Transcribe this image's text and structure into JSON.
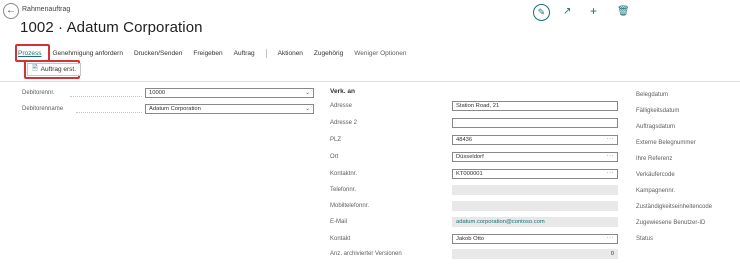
{
  "header": {
    "page_kind": "Rahmenauftrag",
    "title": "1002 · Adatum Corporation"
  },
  "menu": [
    "Prozess",
    "Genehmigung anfordern",
    "Drucken/Senden",
    "Freigeben",
    "Auftrag",
    "Aktionen",
    "Zugehörig",
    "Weniger Optionen"
  ],
  "actions": {
    "create_order": "Auftrag erst."
  },
  "left_fields": [
    {
      "label": "Debitorennr.",
      "value": "10000"
    },
    {
      "label": "Debitorenname",
      "value": "Adatum Corporation"
    }
  ],
  "sell_to": {
    "heading": "Verk. an",
    "fields": [
      {
        "label": "Adresse",
        "value": "Station Road, 21"
      },
      {
        "label": "Adresse 2",
        "value": ""
      },
      {
        "label": "PLZ",
        "value": "48436"
      },
      {
        "label": "Ort",
        "value": "Düsseldorf"
      },
      {
        "label": "Kontaktnr.",
        "value": "KT000001"
      },
      {
        "label": "Telefonnr.",
        "value": ""
      },
      {
        "label": "Mobiltelefonnr.",
        "value": ""
      },
      {
        "label": "E-Mail",
        "value": "adatum.corporation@contoso.com"
      },
      {
        "label": "Kontakt",
        "value": "Jakob Otto"
      },
      {
        "label": "Anz. archivierter Versionen",
        "value": "0"
      }
    ]
  },
  "right_labels": [
    "Belegdatum",
    "Fälligkeitsdatum",
    "Auftragsdatum",
    "Externe Belegnummer",
    "Ihre Referenz",
    "Verkäufercode",
    "Kampagnennr.",
    "Zuständigkeitseinheitencode",
    "Zugewiesene Benutzer-ID",
    "Status"
  ],
  "icons": {
    "back": "back-arrow-icon",
    "edit": "pencil-icon",
    "share": "share-icon",
    "new": "plus-icon",
    "delete": "trash-icon",
    "document": "document-icon"
  },
  "colors": {
    "accent": "#1a6f74",
    "highlight_box": "#d13438"
  }
}
